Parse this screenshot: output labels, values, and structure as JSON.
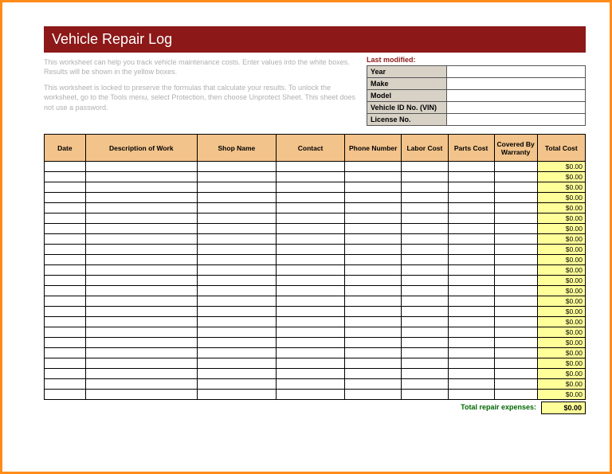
{
  "header": {
    "title": "Vehicle Repair Log"
  },
  "instructions": {
    "p1": "This worksheet can help you track vehicle maintenance costs. Enter values into the white boxes. Results will be shown in the yellow boxes.",
    "p2": "This worksheet is locked to preserve the formulas that calculate your results. To unlock the worksheet, go to the Tools menu, select Protection, then choose Unprotect Sheet. This sheet does not use a password."
  },
  "info": {
    "lastModifiedLabel": "Last modified:",
    "fields": [
      {
        "label": "Year",
        "value": ""
      },
      {
        "label": "Make",
        "value": ""
      },
      {
        "label": "Model",
        "value": ""
      },
      {
        "label": "Vehicle ID No. (VIN)",
        "value": ""
      },
      {
        "label": "License No.",
        "value": ""
      }
    ]
  },
  "columns": {
    "date": "Date",
    "desc": "Description of Work",
    "shop": "Shop Name",
    "contact": "Contact",
    "phone": "Phone Number",
    "labor": "Labor Cost",
    "parts": "Parts Cost",
    "warranty": "Covered By Warranty",
    "total": "Total Cost"
  },
  "rows": [
    {
      "total": "$0.00"
    },
    {
      "total": "$0.00"
    },
    {
      "total": "$0.00"
    },
    {
      "total": "$0.00"
    },
    {
      "total": "$0.00"
    },
    {
      "total": "$0.00"
    },
    {
      "total": "$0.00"
    },
    {
      "total": "$0.00"
    },
    {
      "total": "$0.00"
    },
    {
      "total": "$0.00"
    },
    {
      "total": "$0.00"
    },
    {
      "total": "$0.00"
    },
    {
      "total": "$0.00"
    },
    {
      "total": "$0.00"
    },
    {
      "total": "$0.00"
    },
    {
      "total": "$0.00"
    },
    {
      "total": "$0.00"
    },
    {
      "total": "$0.00"
    },
    {
      "total": "$0.00"
    },
    {
      "total": "$0.00"
    },
    {
      "total": "$0.00"
    },
    {
      "total": "$0.00"
    },
    {
      "total": "$0.00"
    }
  ],
  "footer": {
    "label": "Total repair expenses:",
    "total": "$0.00"
  }
}
